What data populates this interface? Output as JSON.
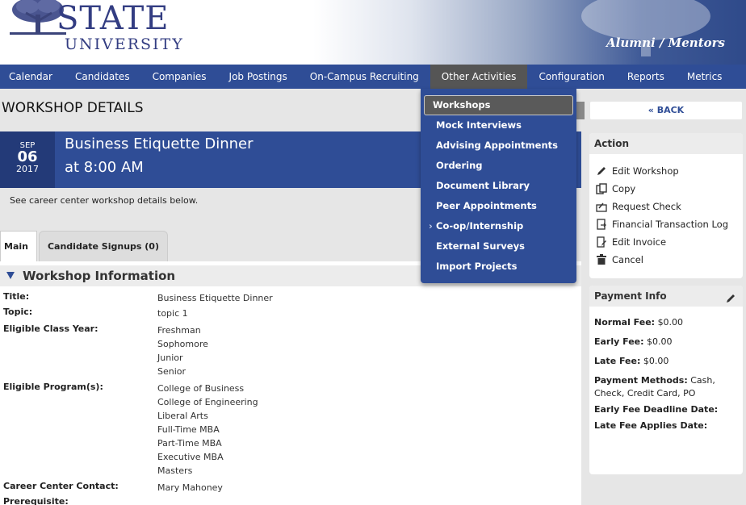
{
  "header": {
    "logo_word": "STATE",
    "logo_sub": "UNIVERSITY",
    "portal_name": "Alumni / Mentors"
  },
  "nav": {
    "items": [
      {
        "label": "Calendar"
      },
      {
        "label": "Candidates"
      },
      {
        "label": "Companies"
      },
      {
        "label": "Job Postings"
      },
      {
        "label": "On-Campus Recruiting"
      },
      {
        "label": "Other Activities"
      },
      {
        "label": "Configuration"
      },
      {
        "label": "Reports"
      },
      {
        "label": "Metrics"
      }
    ],
    "active": "Other Activities"
  },
  "dropdown": {
    "items": [
      {
        "label": "Workshops"
      },
      {
        "label": "Mock Interviews"
      },
      {
        "label": "Advising Appointments"
      },
      {
        "label": "Ordering"
      },
      {
        "label": "Document Library"
      },
      {
        "label": "Peer Appointments"
      },
      {
        "label": "Co-op/Internship"
      },
      {
        "label": "External Surveys"
      },
      {
        "label": "Import Projects"
      }
    ],
    "highlighted": "Workshops"
  },
  "page": {
    "title": "WORKSHOP DETAILS",
    "intro": "See career center workshop details below."
  },
  "event": {
    "month": "SEP",
    "day": "06",
    "year": "2017",
    "title": "Business Etiquette Dinner",
    "time": "at 8:00 AM"
  },
  "tabs": [
    {
      "label": "Main"
    },
    {
      "label": "Candidate Signups (0)"
    }
  ],
  "info": {
    "section_title": "Workshop Information",
    "rows": [
      {
        "label": "Title:",
        "values": [
          "Business Etiquette Dinner"
        ]
      },
      {
        "label": "Topic:",
        "values": [
          "topic 1"
        ]
      },
      {
        "label": "Eligible Class Year:",
        "values": [
          "Freshman",
          "Sophomore",
          "Junior",
          "Senior"
        ]
      },
      {
        "label": "Eligible Program(s):",
        "values": [
          "College of Business",
          "College of Engineering",
          "Liberal Arts",
          "Full-Time MBA",
          "Part-Time MBA",
          "Executive MBA",
          "Masters"
        ]
      },
      {
        "label": "Career Center Contact:",
        "values": [
          "Mary Mahoney"
        ]
      },
      {
        "label": "Prerequisite:",
        "values": []
      }
    ]
  },
  "sidebar": {
    "back_label": "« BACK",
    "action_title": "Action",
    "actions": [
      {
        "label": "Edit Workshop",
        "icon": "pencil-icon"
      },
      {
        "label": "Copy",
        "icon": "copy-icon"
      },
      {
        "label": "Request Check",
        "icon": "check-request-icon"
      },
      {
        "label": "Financial Transaction Log",
        "icon": "transaction-log-icon"
      },
      {
        "label": "Edit Invoice",
        "icon": "invoice-edit-icon"
      },
      {
        "label": "Cancel",
        "icon": "trash-icon"
      }
    ],
    "payment_title": "Payment Info",
    "payment": {
      "normal_fee_label": "Normal Fee:",
      "normal_fee": "$0.00",
      "early_fee_label": "Early Fee:",
      "early_fee": "$0.00",
      "late_fee_label": "Late Fee:",
      "late_fee": "$0.00",
      "methods_label": "Payment Methods:",
      "methods_first": "Cash,",
      "methods_rest": "Check, Credit Card, PO",
      "early_deadline_label": "Early Fee Deadline Date:",
      "late_applies_label": "Late Fee Applies Date:"
    }
  }
}
